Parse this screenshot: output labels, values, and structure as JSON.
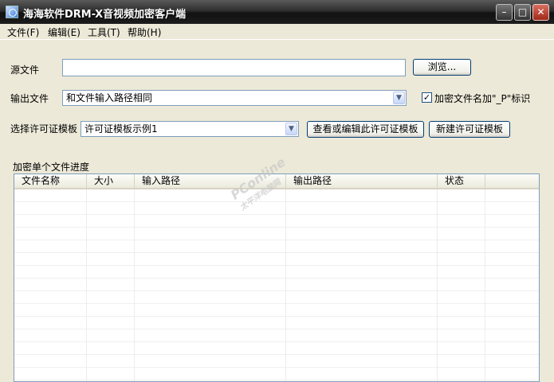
{
  "window": {
    "title": "海海软件DRM-X音视频加密客户端",
    "minimize_glyph": "–",
    "maximize_glyph": "□",
    "close_glyph": "✕"
  },
  "menu": {
    "items": [
      {
        "label": "文件(F)"
      },
      {
        "label": "编辑(E)"
      },
      {
        "label": "工具(T)"
      },
      {
        "label": "帮助(H)"
      }
    ]
  },
  "form": {
    "source_label": "源文件",
    "source_value": "",
    "browse_button": "浏览...",
    "output_label": "输出文件",
    "output_value": "和文件输入路径相同",
    "suffix_checkbox_checked": true,
    "suffix_checkbox_label": "加密文件名加\"_P\"标识",
    "template_label": "选择许可证模板",
    "template_value": "许可证模板示例1",
    "edit_template_button": "查看或编辑此许可证模板",
    "new_template_button": "新建许可证模板"
  },
  "progress": {
    "section_label": "加密单个文件进度",
    "columns": [
      "文件名称",
      "大小",
      "输入路径",
      "输出路径",
      "状态"
    ],
    "rows": []
  },
  "watermark": {
    "text": "PConline",
    "subtext": "太平洋电脑网"
  }
}
